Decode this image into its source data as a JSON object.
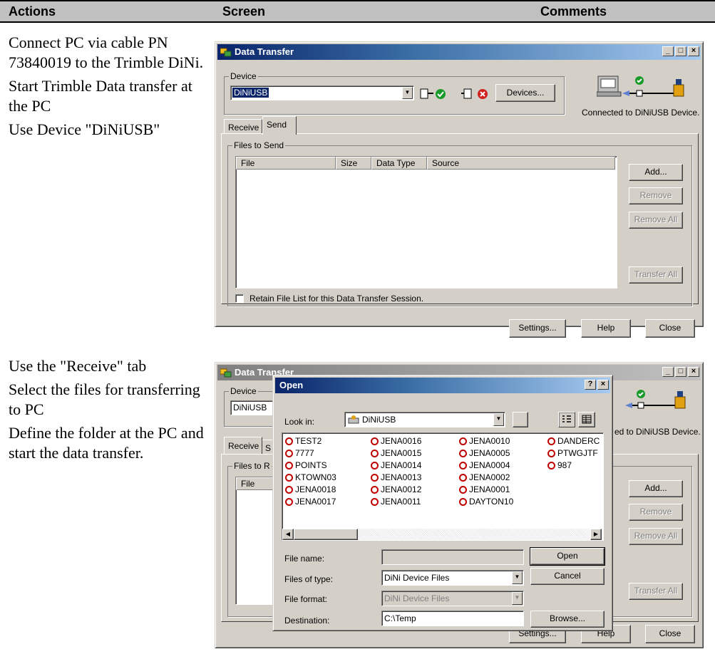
{
  "header": {
    "actions": "Actions",
    "screen": "Screen",
    "comments": "Comments"
  },
  "step1": {
    "paragraphs": [
      "Connect PC via cable PN 73840019 to the Trimble DiNi.",
      "Start Trimble Data transfer at the PC",
      "Use Device \"DiNiUSB\""
    ]
  },
  "step2": {
    "paragraphs": [
      "Use the \"Receive\" tab",
      "Select the files for transferring to PC",
      "Define the folder at the PC and start the data transfer."
    ]
  },
  "win1": {
    "title": "Data Transfer",
    "device_label": "Device",
    "device_value": "DiNiUSB",
    "devices_button": "Devices...",
    "status": "Connected to DiNiUSB Device.",
    "tabs": [
      "Receive",
      "Send"
    ],
    "group_label": "Files to Send",
    "columns": [
      "File",
      "Size",
      "Data Type",
      "Source"
    ],
    "add": "Add...",
    "remove": "Remove",
    "remove_all": "Remove All",
    "transfer_all": "Transfer All",
    "retain": "Retain File List for this Data Transfer Session.",
    "settings": "Settings...",
    "help": "Help",
    "close": "Close"
  },
  "win2": {
    "title": "Data Transfer",
    "device_label": "Device",
    "device_value": "DiNiUSB",
    "status": "ed to DiNiUSB Device.",
    "tab_receive": "Receive",
    "tab_partial": "S",
    "group_label": "Files to R",
    "file_col": "File",
    "add": "Add...",
    "remove": "Remove",
    "remove_all": "Remove All",
    "transfer_all": "Transfer All",
    "settings": "Settings...",
    "help": "Help",
    "close": "Close"
  },
  "open_dialog": {
    "title": "Open",
    "help_glyph": "?",
    "look_in_label": "Look in:",
    "look_in_value": "DiNiUSB",
    "files": [
      [
        "TEST2",
        "7777",
        "POINTS",
        "KTOWN03",
        "JENA0018",
        "JENA0017"
      ],
      [
        "JENA0016",
        "JENA0015",
        "JENA0014",
        "JENA0013",
        "JENA0012",
        "JENA0011"
      ],
      [
        "JENA0010",
        "JENA0005",
        "JENA0004",
        "JENA0002",
        "JENA0001",
        "DAYTON10"
      ],
      [
        "DANDERC",
        "PTWGJTF",
        "987"
      ]
    ],
    "file_name_label": "File name:",
    "file_name_value": "",
    "files_of_type_label": "Files of type:",
    "files_of_type_value": "DiNi Device Files",
    "file_format_label": "File format:",
    "file_format_value": "DiNi Device Files",
    "destination_label": "Destination:",
    "destination_value": "C:\\Temp",
    "open": "Open",
    "cancel": "Cancel",
    "browse": "Browse..."
  }
}
